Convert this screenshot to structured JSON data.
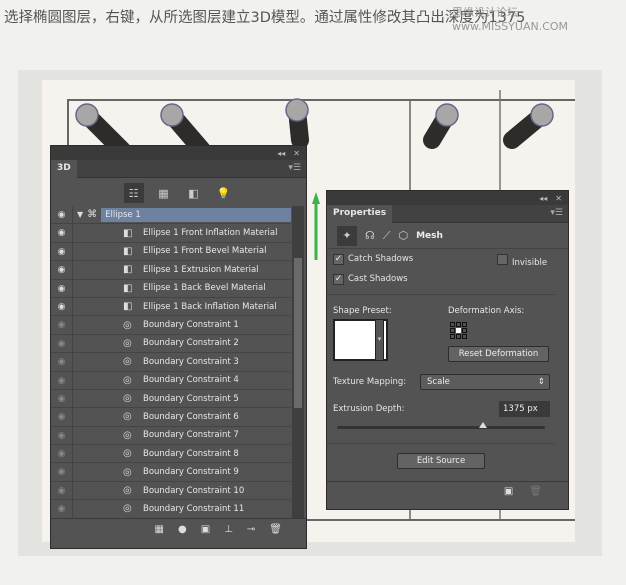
{
  "caption": "选择椭圆图层，右键，从所选图层建立3D模型。通过属性修改其凸出深度为1375",
  "watermark": "思缘设计论坛 www.MISSYUAN.COM",
  "panel3d": {
    "title": "3D",
    "collapse": "◂◂",
    "close": "✕",
    "menu": "▾☰",
    "filter_icons": [
      "scene-icon",
      "mesh-icon",
      "material-icon",
      "light-icon"
    ],
    "rows": [
      {
        "label": "Ellipse 1",
        "icon": "mesh-icon",
        "selected": true,
        "dim": false
      },
      {
        "label": "Ellipse 1 Front Inflation Material",
        "icon": "material-icon",
        "dim": false
      },
      {
        "label": "Ellipse 1 Front Bevel Material",
        "icon": "material-icon",
        "dim": false
      },
      {
        "label": "Ellipse 1 Extrusion Material",
        "icon": "material-icon",
        "dim": false
      },
      {
        "label": "Ellipse 1 Back Bevel Material",
        "icon": "material-icon",
        "dim": false
      },
      {
        "label": "Ellipse 1 Back Inflation Material",
        "icon": "material-icon",
        "dim": false
      },
      {
        "label": "Boundary Constraint 1",
        "icon": "constraint-icon",
        "dim": true
      },
      {
        "label": "Boundary Constraint 2",
        "icon": "constraint-icon",
        "dim": true
      },
      {
        "label": "Boundary Constraint 3",
        "icon": "constraint-icon",
        "dim": true
      },
      {
        "label": "Boundary Constraint 4",
        "icon": "constraint-icon",
        "dim": true
      },
      {
        "label": "Boundary Constraint 5",
        "icon": "constraint-icon",
        "dim": true
      },
      {
        "label": "Boundary Constraint 6",
        "icon": "constraint-icon",
        "dim": true
      },
      {
        "label": "Boundary Constraint 7",
        "icon": "constraint-icon",
        "dim": true
      },
      {
        "label": "Boundary Constraint 8",
        "icon": "constraint-icon",
        "dim": true
      },
      {
        "label": "Boundary Constraint 9",
        "icon": "constraint-icon",
        "dim": true
      },
      {
        "label": "Boundary Constraint 10",
        "icon": "constraint-icon",
        "dim": true
      },
      {
        "label": "Boundary Constraint 11",
        "icon": "constraint-icon",
        "dim": true
      }
    ]
  },
  "properties": {
    "title": "Properties",
    "collapse": "◂◂",
    "close": "✕",
    "menu": "▾☰",
    "mode_label": "Mesh",
    "catch_shadows": {
      "label": "Catch Shadows",
      "checked": true
    },
    "cast_shadows": {
      "label": "Cast Shadows",
      "checked": true
    },
    "invisible": {
      "label": "Invisible",
      "checked": false
    },
    "shape_preset_label": "Shape Preset:",
    "deformation_axis_label": "Deformation Axis:",
    "reset_deformation": "Reset Deformation",
    "texture_mapping_label": "Texture Mapping:",
    "texture_mapping_value": "Scale",
    "extrusion_depth_label": "Extrusion Depth:",
    "extrusion_depth_value": "1375 px",
    "extrusion_slider_fraction": 0.7,
    "edit_source": "Edit Source"
  },
  "accent": "#6d82a0"
}
